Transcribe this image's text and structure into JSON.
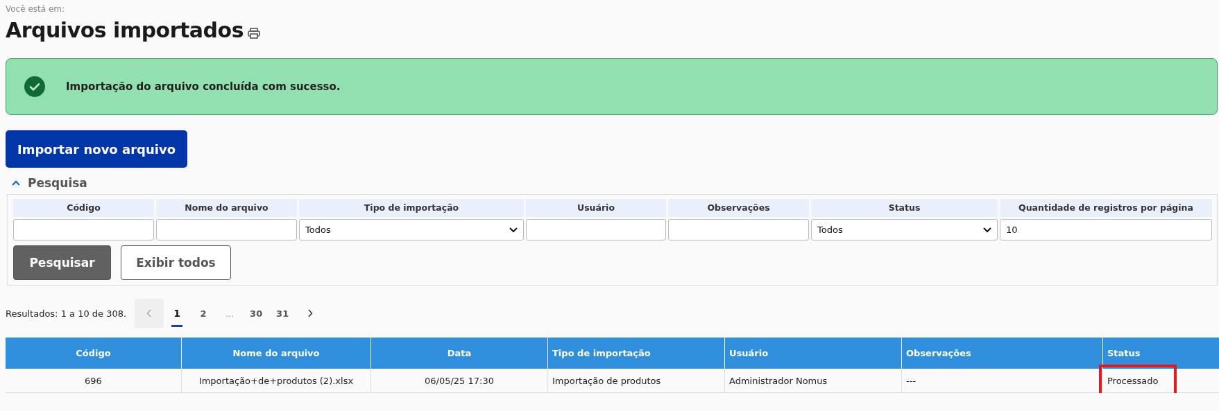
{
  "breadcrumb_label": "Você está em:",
  "page_title": "Arquivos importados",
  "alert": {
    "kind": "success",
    "message": "Importação do arquivo concluída com sucesso."
  },
  "import_button": "Importar novo arquivo",
  "search_panel": {
    "title": "Pesquisa",
    "expanded": true,
    "fields": [
      {
        "label": "Código",
        "kind": "text"
      },
      {
        "label": "Nome do arquivo",
        "kind": "text"
      },
      {
        "label": "Tipo de importação",
        "kind": "select",
        "value": "Todos"
      },
      {
        "label": "Usuário",
        "kind": "text"
      },
      {
        "label": "Observações",
        "kind": "text"
      },
      {
        "label": "Status",
        "kind": "select",
        "value": "Todos"
      },
      {
        "label": "Quantidade de registros por página",
        "kind": "text",
        "value": "10"
      }
    ],
    "buttons": [
      {
        "label": "Pesquisar",
        "kind": "primary"
      },
      {
        "label": "Exibir todos",
        "kind": "secondary"
      }
    ]
  },
  "results_summary": "Resultados: 1 a 10 de 308.",
  "pagination": {
    "previous_disabled": true,
    "next_disabled": false,
    "pages": [
      {
        "label": "1",
        "selected": true,
        "kind": "page"
      },
      {
        "label": "2",
        "selected": false,
        "kind": "page"
      },
      {
        "label": "...",
        "kind": "ellipsis"
      },
      {
        "label": "30",
        "selected": false,
        "kind": "page"
      },
      {
        "label": "31",
        "selected": false,
        "kind": "page"
      }
    ]
  },
  "table": {
    "columns": [
      "Código",
      "Nome do arquivo",
      "Data",
      "Tipo de importação",
      "Usuário",
      "Observações",
      "Status"
    ],
    "rows": [
      {
        "cells": [
          {
            "text": "696",
            "highlighted": false
          },
          {
            "text": "Importação+de+produtos (2).xlsx",
            "highlighted": false
          },
          {
            "text": "06/05/25 17:30",
            "highlighted": false
          },
          {
            "text": "Importação de produtos",
            "highlighted": false
          },
          {
            "text": "Administrador Nomus",
            "highlighted": false
          },
          {
            "text": "---",
            "highlighted": false
          },
          {
            "text": "Processado",
            "highlighted": true
          }
        ]
      }
    ]
  }
}
